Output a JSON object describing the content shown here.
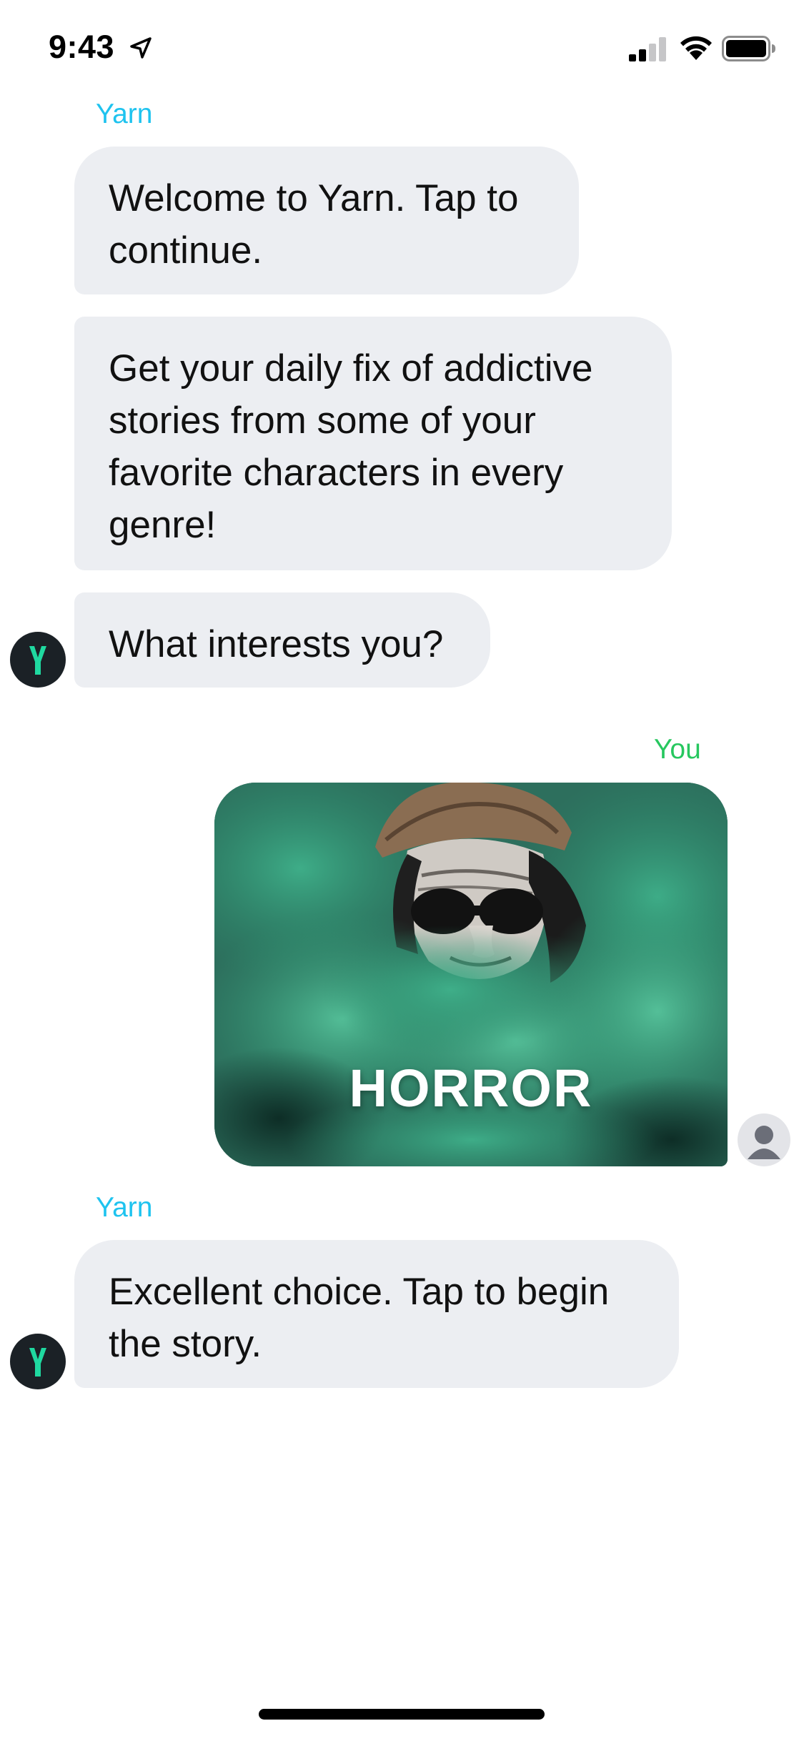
{
  "status_bar": {
    "time": "9:43"
  },
  "chat": {
    "messages": [
      {
        "sender": "Yarn",
        "text": "Welcome to Yarn. Tap to continue."
      },
      {
        "sender": "",
        "text": "Get your daily fix of addictive stories from some of your favorite characters in every genre!"
      },
      {
        "sender": "",
        "text": "What interests you?"
      },
      {
        "sender": "You",
        "text": "HORROR"
      },
      {
        "sender": "Yarn",
        "text": "Excellent choice. Tap to begin the story."
      }
    ],
    "avatar_letter": "Y"
  },
  "colors": {
    "yarn_label": "#1ec3ef",
    "you_label": "#27c75f",
    "bubble_bg": "#eceef2",
    "avatar_bg": "#1b2126",
    "avatar_letter": "#1fd9a0"
  },
  "icons": {
    "location": "location-arrow-icon",
    "signal": "cellular-signal-icon",
    "wifi": "wifi-icon",
    "battery": "battery-icon",
    "user": "user-avatar-icon"
  }
}
